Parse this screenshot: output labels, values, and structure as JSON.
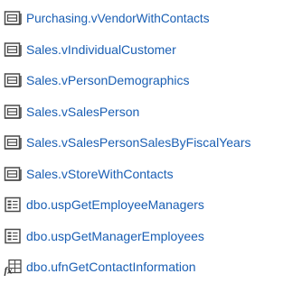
{
  "items": [
    {
      "label": "Purchasing.vVendorWithContacts",
      "icon": "view-icon"
    },
    {
      "label": "Sales.vIndividualCustomer",
      "icon": "view-icon"
    },
    {
      "label": "Sales.vPersonDemographics",
      "icon": "view-icon"
    },
    {
      "label": "Sales.vSalesPerson",
      "icon": "view-icon"
    },
    {
      "label": "Sales.vSalesPersonSalesByFiscalYears",
      "icon": "view-icon"
    },
    {
      "label": "Sales.vStoreWithContacts",
      "icon": "view-icon"
    },
    {
      "label": "dbo.uspGetEmployeeManagers",
      "icon": "stored-procedure-icon"
    },
    {
      "label": "dbo.uspGetManagerEmployees",
      "icon": "stored-procedure-icon"
    },
    {
      "label": "dbo.ufnGetContactInformation",
      "icon": "function-icon"
    }
  ],
  "colors": {
    "link": "#1a5fb4",
    "icon_stroke": "#4a4a4a"
  }
}
